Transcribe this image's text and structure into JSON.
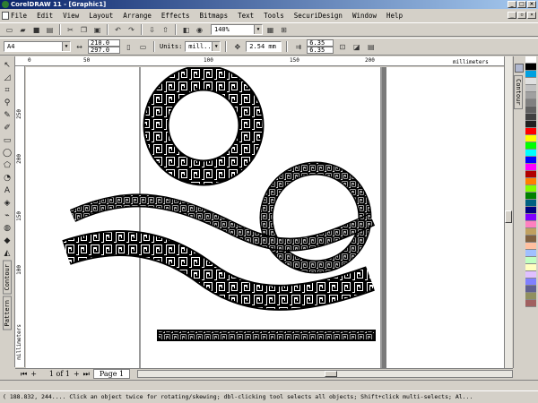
{
  "window": {
    "title": "CorelDRAW 11 - [Graphic1]"
  },
  "menu": [
    "File",
    "Edit",
    "View",
    "Layout",
    "Arrange",
    "Effects",
    "Bitmaps",
    "Text",
    "Tools",
    "SecuriDesign",
    "Window",
    "Help"
  ],
  "toolbar": {
    "zoom": "140%"
  },
  "property_bar": {
    "page_size": "A4",
    "width": "210.0",
    "height": "297.0",
    "units_label": "Units:",
    "units": "mill...",
    "nudge": "2.54 mm",
    "dup_x": "6.35",
    "dup_y": "6.35"
  },
  "ruler": {
    "h_labels": [
      "0",
      "50",
      "100",
      "150",
      "200"
    ],
    "h_unit": "millimeters",
    "v_labels": [
      "250",
      "200",
      "150",
      "100"
    ],
    "v_unit": "millimeters"
  },
  "dockers": {
    "contour": "Contour",
    "pattern": "Pattern"
  },
  "page_nav": {
    "counter": "1 of 1",
    "tab": "Page 1"
  },
  "status": {
    "text": "( 188.832, 244.... Click an object twice for rotating/skewing; dbl-clicking tool selects all objects; Shift+click multi-selects; Al..."
  },
  "palette": [
    "#ffffff",
    "#000000",
    "#00a0e0",
    "#e0e0e0",
    "#c0c0c0",
    "#a0a0a0",
    "#808080",
    "#606060",
    "#404040",
    "#202020",
    "#ff0000",
    "#ffff00",
    "#00ff00",
    "#00ffff",
    "#0000ff",
    "#ff00ff",
    "#b00000",
    "#ff8000",
    "#80ff00",
    "#008000",
    "#006080",
    "#000080",
    "#8000ff",
    "#ff80c0",
    "#c0a060",
    "#806040",
    "#ffc0a0",
    "#a0c0ff",
    "#c0ffc0",
    "#ffffc0",
    "#e0c0ff",
    "#8080ff",
    "#606090",
    "#909060",
    "#a06060"
  ]
}
